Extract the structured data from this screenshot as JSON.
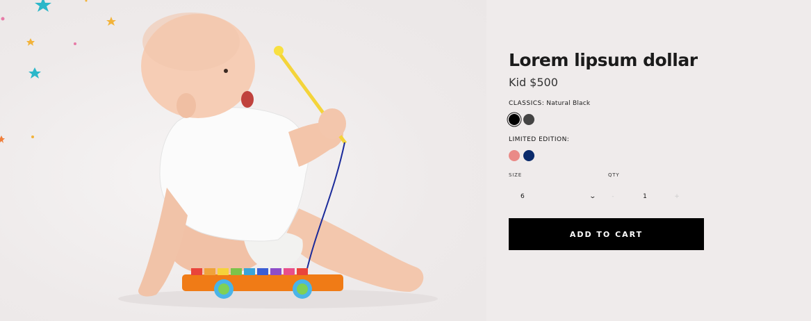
{
  "product": {
    "title": "Lorem lipsum dollar",
    "price": "Kid $500",
    "classics": {
      "label": "CLASSICS:",
      "value": "Natural Black",
      "swatches": [
        {
          "name": "black",
          "color": "#000000",
          "selected": true
        },
        {
          "name": "dark-grey",
          "color": "#444444",
          "selected": false
        }
      ]
    },
    "limited": {
      "label": "LIMITED EDITION:",
      "swatches": [
        {
          "name": "salmon",
          "color": "#ea8a87",
          "selected": false
        },
        {
          "name": "navy",
          "color": "#0a2a6b",
          "selected": false
        }
      ]
    },
    "size_label": "SIZE",
    "qty_label": "QTY",
    "size_value": "6",
    "qty_value": "1",
    "qty_minus": "-",
    "qty_plus": "+",
    "cart_label": "ADD TO CART"
  },
  "icons": {
    "dropdown": "chevron-down-icon"
  },
  "colors": {
    "background": "#efebeb",
    "button": "#000000"
  }
}
